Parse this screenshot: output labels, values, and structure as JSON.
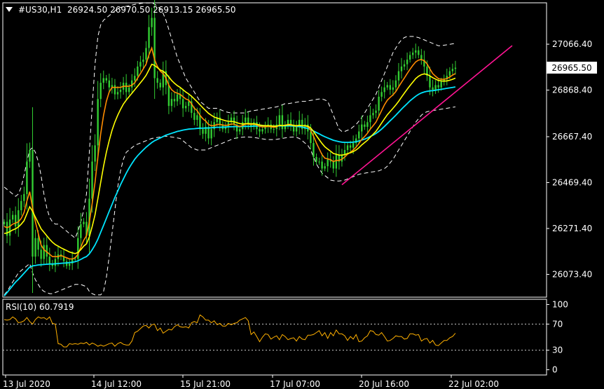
{
  "header": {
    "symbol": "#US30,H1",
    "ohlc": "26924.50 26970.50 26913.15 26965.50"
  },
  "rsi_header": "RSI(10) 60.7919",
  "current_price_label": "26965.50",
  "colors": {
    "background": "#000000",
    "frame": "#ffffff",
    "candle": "#32cd32",
    "ma_fast": "#ff8c00",
    "ma_mid": "#ffff00",
    "ma_slow": "#00e5ff",
    "bands": "#ffffff",
    "trendline": "#ff1493",
    "rsi_line": "#ffb000",
    "price_box_bg": "#ffffff",
    "price_box_text": "#000000"
  },
  "chart_data": [
    {
      "type": "candlestick",
      "panel": "price",
      "symbol": "#US30",
      "timeframe": "H1",
      "y_ticks": [
        26073.4,
        26271.4,
        26469.4,
        26667.4,
        26868.4,
        27066.4
      ],
      "y_tick_labels": [
        "26073.40",
        "26271.40",
        "26469.40",
        "26667.40",
        "26868.40",
        "27066.40"
      ],
      "ylim": [
        25975,
        27245
      ],
      "x_tick_labels": [
        "13 Jul 2020",
        "14 Jul 12:00",
        "15 Jul 21:00",
        "17 Jul 07:00",
        "20 Jul 16:00",
        "22 Jul 02:00"
      ],
      "bars": 160,
      "close_series": [
        26300,
        26240,
        26310,
        26330,
        26280,
        26350,
        26390,
        26420,
        26560,
        26610,
        26150,
        26230,
        26180,
        26140,
        26200,
        26150,
        26120,
        26110,
        26140,
        26160,
        26150,
        26130,
        26110,
        26120,
        26140,
        26140,
        26230,
        26290,
        26300,
        26240,
        26400,
        26560,
        26630,
        26830,
        26900,
        26920,
        26910,
        26880,
        26890,
        26850,
        26860,
        26870,
        26900,
        26860,
        26880,
        26910,
        26930,
        26970,
        26990,
        27000,
        27050,
        27140,
        27180,
        26920,
        26900,
        26880,
        26950,
        26890,
        26800,
        26830,
        26820,
        26850,
        26830,
        26790,
        26800,
        26820,
        26770,
        26740,
        26760,
        26700,
        26680,
        26710,
        26660,
        26700,
        26730,
        26750,
        26720,
        26700,
        26710,
        26730,
        26750,
        26720,
        26690,
        26700,
        26730,
        26750,
        26720,
        26710,
        26730,
        26700,
        26690,
        26700,
        26710,
        26720,
        26700,
        26700,
        26720,
        26760,
        26700,
        26720,
        26740,
        26720,
        26690,
        26710,
        26740,
        26700,
        26720,
        26690,
        26640,
        26580,
        26560,
        26560,
        26530,
        26540,
        26570,
        26560,
        26530,
        26590,
        26560,
        26590,
        26610,
        26630,
        26620,
        26640,
        26660,
        26690,
        26720,
        26710,
        26730,
        26760,
        26770,
        26780,
        26840,
        26860,
        26880,
        26890,
        26870,
        26880,
        26910,
        26950,
        26970,
        26980,
        27000,
        27020,
        27030,
        27040,
        27020,
        27000,
        26970,
        26930,
        26880,
        26870,
        26890,
        26880,
        26905,
        26915,
        26930,
        26950,
        26960,
        26965
      ],
      "ma_fast": [
        26280,
        26275,
        26280,
        26290,
        26295,
        26300,
        26315,
        26340,
        26390,
        26430,
        26360,
        26300,
        26250,
        26200,
        26180,
        26170,
        26160,
        26150,
        26150,
        26150,
        26155,
        26150,
        26145,
        26140,
        26140,
        26145,
        26160,
        26190,
        26220,
        26240,
        26300,
        26380,
        26470,
        26580,
        26680,
        26760,
        26820,
        26860,
        26880,
        26880,
        26880,
        26880,
        26885,
        26885,
        26885,
        26890,
        26900,
        26920,
        26940,
        26960,
        26980,
        27020,
        27050,
        27000,
        26970,
        26950,
        26940,
        26920,
        26890,
        26870,
        26860,
        26855,
        26850,
        26840,
        26830,
        26825,
        26810,
        26790,
        26780,
        26760,
        26745,
        26735,
        26720,
        26715,
        26715,
        26720,
        26720,
        26718,
        26716,
        26718,
        26722,
        26722,
        26715,
        26712,
        26715,
        26722,
        26722,
        26720,
        26722,
        26718,
        26712,
        26710,
        26710,
        26712,
        26710,
        26708,
        26710,
        26718,
        26715,
        26716,
        26720,
        26720,
        26715,
        26713,
        26717,
        26714,
        26715,
        26710,
        26695,
        26670,
        26640,
        26615,
        26590,
        26575,
        26572,
        26568,
        26560,
        26565,
        26565,
        26570,
        26580,
        26592,
        26600,
        26610,
        26622,
        26638,
        26656,
        26668,
        26682,
        26700,
        26715,
        26730,
        26755,
        26780,
        26805,
        26825,
        26837,
        26848,
        26862,
        26882,
        26902,
        26920,
        26940,
        26958,
        26975,
        26990,
        26998,
        27000,
        26995,
        26982,
        26960,
        26940,
        26928,
        26918,
        26915,
        26915,
        26918,
        26925,
        26933,
        26940
      ],
      "ma_mid": [
        26250,
        26252,
        26258,
        26265,
        26270,
        26278,
        26290,
        26305,
        26335,
        26365,
        26345,
        26320,
        26295,
        26270,
        26255,
        26240,
        26225,
        26212,
        26202,
        26195,
        26188,
        26182,
        26176,
        26170,
        26166,
        26163,
        26168,
        26180,
        26195,
        26205,
        26235,
        26280,
        26330,
        26400,
        26470,
        26540,
        26600,
        26650,
        26695,
        26730,
        26760,
        26785,
        26808,
        26825,
        26840,
        26855,
        26870,
        26885,
        26900,
        26915,
        26932,
        26955,
        26980,
        26975,
        26965,
        26955,
        26950,
        26940,
        26925,
        26910,
        26898,
        26888,
        26880,
        26870,
        26860,
        26852,
        26842,
        26830,
        26818,
        26805,
        26792,
        26780,
        26768,
        26760,
        26752,
        26748,
        26744,
        26740,
        26736,
        26734,
        26733,
        26732,
        26728,
        26724,
        26722,
        26724,
        26724,
        26723,
        26723,
        26721,
        26718,
        26716,
        26715,
        26715,
        26714,
        26713,
        26713,
        26716,
        26715,
        26716,
        26718,
        26718,
        26716,
        26715,
        26716,
        26715,
        26715,
        26713,
        26705,
        26690,
        26672,
        26655,
        26638,
        26624,
        26614,
        26605,
        26595,
        26592,
        26588,
        26588,
        26590,
        26595,
        26598,
        26603,
        26610,
        26620,
        26632,
        26642,
        26652,
        26665,
        26678,
        26690,
        26708,
        26726,
        26745,
        26762,
        26776,
        26790,
        26804,
        26820,
        26838,
        26855,
        26872,
        26888,
        26903,
        26918,
        26928,
        26935,
        26938,
        26936,
        26930,
        26922,
        26916,
        26910,
        26908,
        26907,
        26908,
        26911,
        26915,
        26920
      ],
      "ma_slow": [
        25980,
        25995,
        26010,
        26025,
        26040,
        26052,
        26065,
        26078,
        26092,
        26105,
        26110,
        26112,
        26114,
        26115,
        26116,
        26117,
        26118,
        26118,
        26119,
        26120,
        26121,
        26122,
        26123,
        26124,
        26126,
        26128,
        26132,
        26138,
        26145,
        26150,
        26162,
        26180,
        26200,
        26225,
        26255,
        26285,
        26315,
        26345,
        26375,
        26405,
        26432,
        26460,
        26485,
        26510,
        26532,
        26552,
        26570,
        26585,
        26598,
        26610,
        26622,
        26632,
        26642,
        26650,
        26656,
        26662,
        26668,
        26674,
        26678,
        26682,
        26686,
        26690,
        26693,
        26696,
        26698,
        26700,
        26701,
        26702,
        26703,
        26704,
        26704,
        26705,
        26705,
        26706,
        26707,
        26708,
        26708,
        26709,
        26709,
        26710,
        26710,
        26711,
        26711,
        26711,
        26712,
        26712,
        26712,
        26712,
        26713,
        26713,
        26713,
        26713,
        26713,
        26713,
        26713,
        26713,
        26713,
        26714,
        26714,
        26714,
        26714,
        26714,
        26713,
        26712,
        26711,
        26709,
        26706,
        26703,
        26698,
        26692,
        26686,
        26680,
        26673,
        26667,
        26662,
        26657,
        26652,
        26649,
        26646,
        26644,
        26643,
        26643,
        26643,
        26644,
        26646,
        26649,
        26653,
        26657,
        26662,
        26668,
        26674,
        26681,
        26690,
        26700,
        26712,
        26724,
        26736,
        26748,
        26760,
        26773,
        26786,
        26798,
        26810,
        26822,
        26832,
        26842,
        26850,
        26856,
        26860,
        26863,
        26865,
        26866,
        26868,
        26870,
        26872,
        26874,
        26876,
        26878,
        26880,
        26882
      ],
      "band_upper": [
        26450,
        26440,
        26430,
        26420,
        26410,
        26420,
        26450,
        26500,
        26560,
        26610,
        26620,
        26600,
        26560,
        26500,
        26420,
        26360,
        26320,
        26300,
        26290,
        26290,
        26280,
        26270,
        26260,
        26250,
        26240,
        26230,
        26260,
        26300,
        26350,
        26420,
        26600,
        26800,
        26980,
        27100,
        27150,
        27170,
        27180,
        27190,
        27200,
        27210,
        27220,
        27225,
        27228,
        27230,
        27232,
        27235,
        27238,
        27240,
        27242,
        27244,
        27244,
        27244,
        27244,
        27240,
        27230,
        27220,
        27200,
        27170,
        27130,
        27090,
        27050,
        27010,
        26980,
        26950,
        26920,
        26900,
        26880,
        26860,
        26840,
        26820,
        26810,
        26800,
        26790,
        26790,
        26790,
        26790,
        26785,
        26780,
        26775,
        26772,
        26770,
        26770,
        26770,
        26770,
        26770,
        26770,
        26775,
        26778,
        26780,
        26782,
        26784,
        26786,
        26788,
        26790,
        26792,
        26794,
        26796,
        26800,
        26805,
        26810,
        26810,
        26812,
        26814,
        26816,
        26818,
        26820,
        26820,
        26822,
        26824,
        26826,
        26828,
        26830,
        26830,
        26826,
        26820,
        26790,
        26760,
        26730,
        26700,
        26690,
        26690,
        26695,
        26700,
        26710,
        26720,
        26735,
        26750,
        26770,
        26790,
        26810,
        26830,
        26850,
        26880,
        26910,
        26940,
        26970,
        27000,
        27030,
        27050,
        27070,
        27085,
        27095,
        27100,
        27100,
        27100,
        27098,
        27095,
        27090,
        27085,
        27080,
        27075,
        27070,
        27065,
        27060,
        27060,
        27062,
        27064,
        27066,
        27068,
        27070
      ],
      "band_lower": [
        25985,
        26000,
        26020,
        26040,
        26060,
        26080,
        26090,
        26100,
        26110,
        26120,
        26080,
        26050,
        26030,
        26010,
        26000,
        25995,
        25990,
        25990,
        25995,
        26000,
        26005,
        26010,
        26015,
        26020,
        26025,
        26030,
        26030,
        26030,
        26025,
        26020,
        26000,
        25990,
        25985,
        25985,
        25985,
        26000,
        26060,
        26150,
        26250,
        26350,
        26450,
        26520,
        26570,
        26600,
        26610,
        26620,
        26630,
        26635,
        26640,
        26645,
        26650,
        26655,
        26660,
        26662,
        26664,
        26666,
        26668,
        26670,
        26668,
        26666,
        26664,
        26662,
        26660,
        26650,
        26640,
        26630,
        26620,
        26615,
        26610,
        26610,
        26610,
        26610,
        26615,
        26620,
        26625,
        26630,
        26635,
        26640,
        26645,
        26650,
        26655,
        26660,
        26662,
        26664,
        26665,
        26666,
        26666,
        26665,
        26664,
        26662,
        26660,
        26658,
        26656,
        26655,
        26655,
        26655,
        26656,
        26658,
        26660,
        26662,
        26664,
        26665,
        26666,
        26664,
        26660,
        26650,
        26640,
        26630,
        26610,
        26580,
        26550,
        26530,
        26510,
        26500,
        26490,
        26480,
        26478,
        26476,
        26476,
        26478,
        26480,
        26485,
        26490,
        26495,
        26500,
        26505,
        26508,
        26510,
        26512,
        26514,
        26516,
        26518,
        26520,
        26525,
        26530,
        26540,
        26555,
        26570,
        26590,
        26610,
        26630,
        26650,
        26670,
        26690,
        26710,
        26730,
        26745,
        26760,
        26770,
        26775,
        26778,
        26780,
        26782,
        26784,
        26786,
        26788,
        26790,
        26792,
        26794,
        26796
      ],
      "trendline": {
        "start": {
          "bar": 119,
          "price": 26460
        },
        "end": {
          "bar": 179,
          "price": 27060
        }
      },
      "current_price": 26965.5
    },
    {
      "type": "line",
      "panel": "rsi",
      "name": "RSI(10)",
      "y_ticks": [
        0,
        30,
        70,
        100
      ],
      "y_tick_labels": [
        "0",
        "30",
        "70",
        "100"
      ],
      "levels": [
        30,
        70
      ],
      "ylim": [
        -8,
        108
      ],
      "values": [
        77,
        76,
        77,
        81,
        78,
        72,
        73,
        75,
        80,
        74,
        70,
        77,
        81,
        79,
        80,
        77,
        81,
        71,
        70,
        40,
        39,
        35,
        35,
        40,
        39,
        40,
        39,
        41,
        40,
        42,
        38,
        41,
        39,
        36,
        38,
        36,
        38,
        40,
        41,
        36,
        40,
        42,
        39,
        38,
        38,
        44,
        57,
        59,
        63,
        67,
        68,
        64,
        69,
        70,
        60,
        64,
        56,
        59,
        62,
        61,
        66,
        69,
        66,
        65,
        66,
        64,
        72,
        74,
        72,
        84,
        81,
        76,
        76,
        72,
        75,
        69,
        71,
        67,
        67,
        71,
        69,
        71,
        72,
        76,
        78,
        80,
        75,
        54,
        58,
        51,
        43,
        50,
        55,
        54,
        47,
        50,
        52,
        46,
        54,
        51,
        46,
        48,
        49,
        44,
        51,
        47,
        46,
        53,
        53,
        54,
        57,
        60,
        52,
        57,
        48,
        57,
        52,
        61,
        55,
        55,
        52,
        45,
        51,
        47,
        54,
        43,
        44,
        49,
        52,
        60,
        59,
        54,
        53,
        57,
        51,
        44,
        45,
        48,
        52,
        51,
        51,
        47,
        48,
        55,
        55,
        53,
        54,
        44,
        47,
        48,
        41,
        45,
        38,
        37,
        41,
        45,
        45,
        49,
        51,
        56
      ]
    }
  ]
}
